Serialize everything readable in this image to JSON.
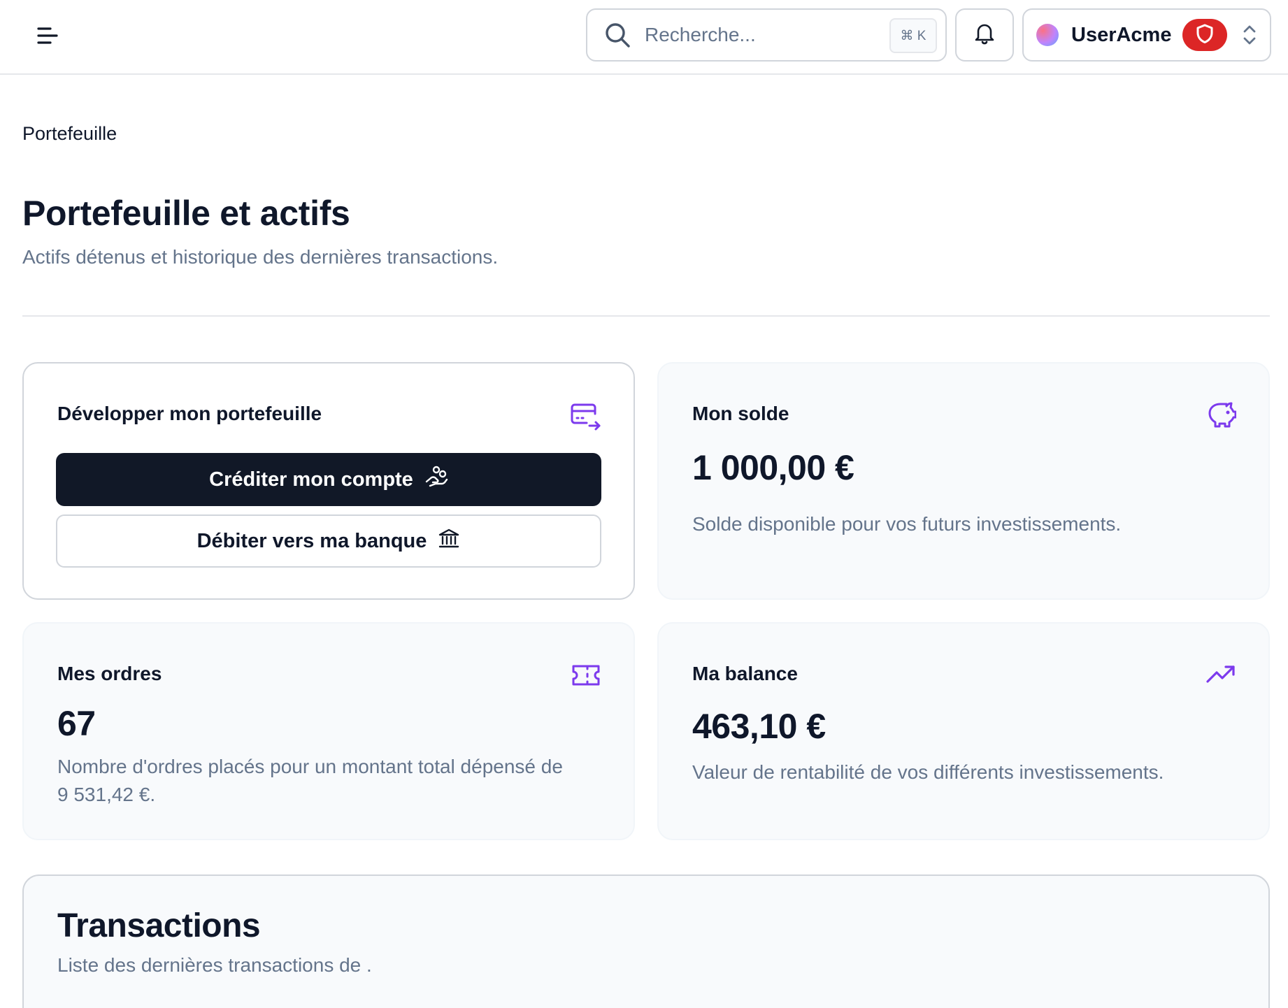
{
  "header": {
    "search": {
      "placeholder": "Recherche...",
      "shortcut": "⌘ K"
    },
    "user": {
      "name": "UserAcme"
    },
    "icons": {
      "menu": "menu-icon",
      "search": "search-icon",
      "bell": "bell-icon",
      "shield": "shield-icon",
      "selector": "chevrons-up-down-icon"
    }
  },
  "breadcrumb": "Portefeuille",
  "page": {
    "title": "Portefeuille et actifs",
    "subtitle": "Actifs détenus et historique des dernières transactions."
  },
  "cards": {
    "develop": {
      "title": "Développer mon portefeuille",
      "credit_label": "Créditer mon compte",
      "debit_label": "Débiter vers ma banque"
    },
    "solde": {
      "title": "Mon solde",
      "value": "1 000,00 €",
      "description": "Solde disponible pour vos futurs investissements."
    },
    "ordres": {
      "title": "Mes ordres",
      "value": "67",
      "description_line1": "Nombre d'ordres placés pour un montant total dépensé de",
      "description_line2": "9 531,42 €."
    },
    "balance": {
      "title": "Ma balance",
      "value": "463,10 €",
      "description": "Valeur de rentabilité de vos différents investissements."
    }
  },
  "transactions": {
    "title": "Transactions",
    "subtitle": "Liste des dernières transactions de ."
  },
  "colors": {
    "accent": "#7c3aed",
    "primary_button": "#111827",
    "badge": "#dc2626",
    "muted_text": "#64748b"
  }
}
